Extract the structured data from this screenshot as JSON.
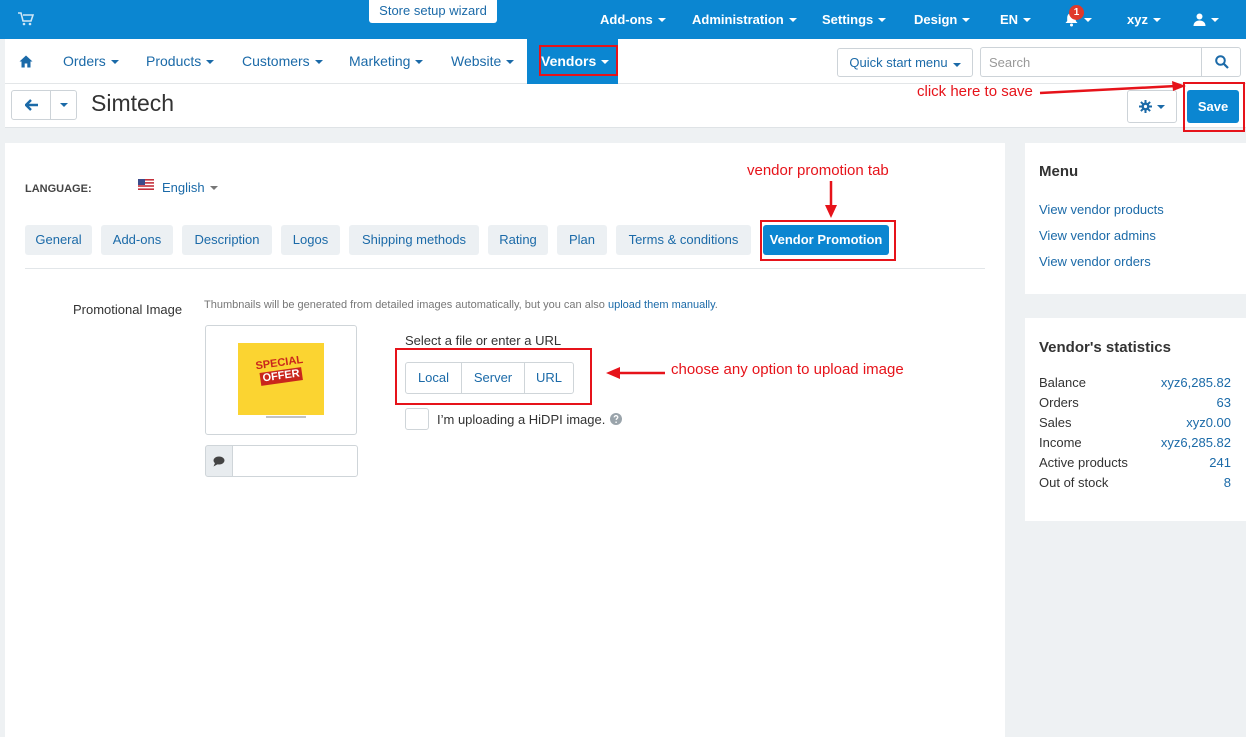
{
  "topbar": {
    "wizard": "Store setup wizard",
    "items": [
      "Add-ons",
      "Administration",
      "Settings",
      "Design",
      "EN"
    ],
    "notification_count": "1",
    "user": "xyz"
  },
  "secnav": {
    "items": [
      "Orders",
      "Products",
      "Customers",
      "Marketing",
      "Website",
      "Vendors"
    ],
    "quick_start": "Quick start menu",
    "search_placeholder": "Search"
  },
  "titlebar": {
    "title": "Simtech",
    "save": "Save"
  },
  "content": {
    "language_label": "LANGUAGE:",
    "language_value": "English",
    "tabs": [
      "General",
      "Add-ons",
      "Description",
      "Logos",
      "Shipping methods",
      "Rating",
      "Plan",
      "Terms & conditions",
      "Vendor Promotion"
    ],
    "promo_label": "Promotional Image",
    "hint_text": "Thumbnails will be generated from detailed images automatically, but you can also",
    "hint_link": "upload them manually",
    "hint_end": ".",
    "image_text_1": "SPECIAL",
    "image_text_2": "OFFER",
    "select_label": "Select a file or enter a URL",
    "upload_options": [
      "Local",
      "Server",
      "URL"
    ],
    "hidpi_label": "I’m uploading a HiDPI image."
  },
  "sidebar": {
    "menu_title": "Menu",
    "links": [
      "View vendor products",
      "View vendor admins",
      "View vendor orders"
    ],
    "stats_title": "Vendor's statistics",
    "stats": [
      {
        "label": "Balance",
        "value": "xyz6,285.82"
      },
      {
        "label": "Orders",
        "value": "63"
      },
      {
        "label": "Sales",
        "value": "xyz0.00"
      },
      {
        "label": "Income",
        "value": "xyz6,285.82"
      },
      {
        "label": "Active products",
        "value": "241"
      },
      {
        "label": "Out of stock",
        "value": "8"
      }
    ]
  },
  "annotations": {
    "save": "click here to save",
    "tab": "vendor promotion tab",
    "upload": "choose any option to upload image"
  },
  "colors": {
    "primary": "#0b86d1",
    "link": "#1b6aa8",
    "annotation": "#e6131a"
  }
}
